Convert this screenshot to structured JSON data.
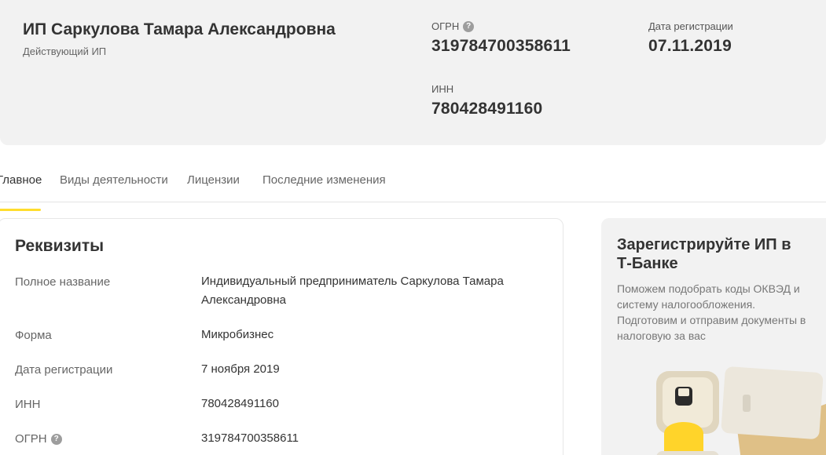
{
  "header": {
    "name": "ИП Саркулова Тамара Александровна",
    "status": "Действующий ИП",
    "ogrn_label": "ОГРН",
    "ogrn_value": "319784700358611",
    "reg_date_label": "Дата регистрации",
    "reg_date_value": "07.11.2019",
    "inn_label": "ИНН",
    "inn_value": "780428491160"
  },
  "tabs": [
    {
      "label": "Главное",
      "active": true
    },
    {
      "label": "Виды деятельности",
      "active": false
    },
    {
      "label": "Лицензии",
      "active": false
    },
    {
      "label": "Последние изменения",
      "active": false
    }
  ],
  "requisites": {
    "title": "Реквизиты",
    "rows": [
      {
        "label": "Полное название",
        "value": "Индивидуальный предприниматель Саркулова Тамара Александровна"
      },
      {
        "label": "Форма",
        "value": "Микробизнес"
      },
      {
        "label": "Дата регистрации",
        "value": "7 ноября 2019"
      },
      {
        "label": "ИНН",
        "value": "780428491160"
      },
      {
        "label": "ОГРН",
        "value": "319784700358611"
      }
    ]
  },
  "promo": {
    "title": "Зарегистрируйте ИП в Т-Банке",
    "text": "Поможем подобрать коды ОКВЭД и систему налогообложения. Подготовим и отправим документы в налоговую за вас"
  },
  "colors": {
    "accent": "#ffdd2d",
    "card_background": "#f2f2f2"
  },
  "icons": {
    "ogrn_help": "question-circle-icon"
  }
}
